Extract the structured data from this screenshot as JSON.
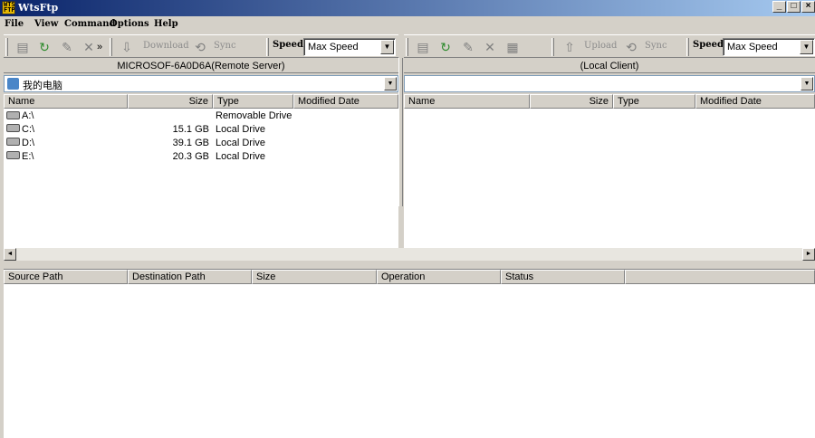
{
  "window": {
    "title": "WtsFtp",
    "app_icon_text": "WTS FTP"
  },
  "window_buttons": {
    "minimize": "_",
    "maximize": "□",
    "close": "×"
  },
  "menu": [
    "File",
    "View",
    "Command",
    "Options",
    "Help"
  ],
  "remote": {
    "caption": "MICROSOF-6A0D6A(Remote Server)",
    "path": "我的电脑",
    "toolbar": {
      "download_label": "Download",
      "sync_label": "Sync",
      "speed_label": "Speed",
      "speed_value": "Max Speed",
      "overflow": "»"
    },
    "columns": [
      "Name",
      "Size",
      "Type",
      "Modified Date"
    ],
    "rows": [
      {
        "name": "A:\\",
        "size": "",
        "type": "Removable Drive",
        "modified": ""
      },
      {
        "name": "C:\\",
        "size": "15.1 GB",
        "type": "Local Drive",
        "modified": ""
      },
      {
        "name": "D:\\",
        "size": "39.1 GB",
        "type": "Local Drive",
        "modified": ""
      },
      {
        "name": "E:\\",
        "size": "20.3 GB",
        "type": "Local Drive",
        "modified": ""
      }
    ]
  },
  "local": {
    "caption": "(Local Client)",
    "path": "",
    "toolbar": {
      "upload_label": "Upload",
      "sync_label": "Sync",
      "speed_label": "Speed",
      "speed_value": "Max Speed"
    },
    "columns": [
      "Name",
      "Size",
      "Type",
      "Modified Date"
    ],
    "rows": []
  },
  "queue": {
    "columns": [
      "Source Path",
      "Destination Path",
      "Size",
      "Operation",
      "Status"
    ],
    "rows": []
  },
  "scrollbar": {
    "left_arrow": "◄",
    "right_arrow": "►"
  },
  "icons": {
    "folder": "folder-icon",
    "refresh": "refresh-icon",
    "rename": "rename-icon",
    "delete": "delete-icon",
    "download": "download-icon",
    "upload": "upload-icon",
    "sync": "sync-icon",
    "dropdown": "chevron-down-icon"
  },
  "colors": {
    "titlebar_start": "#0a246a",
    "titlebar_end": "#a6caf0",
    "chrome": "#d4d0c8",
    "refresh_green": "#2e8b2e"
  }
}
